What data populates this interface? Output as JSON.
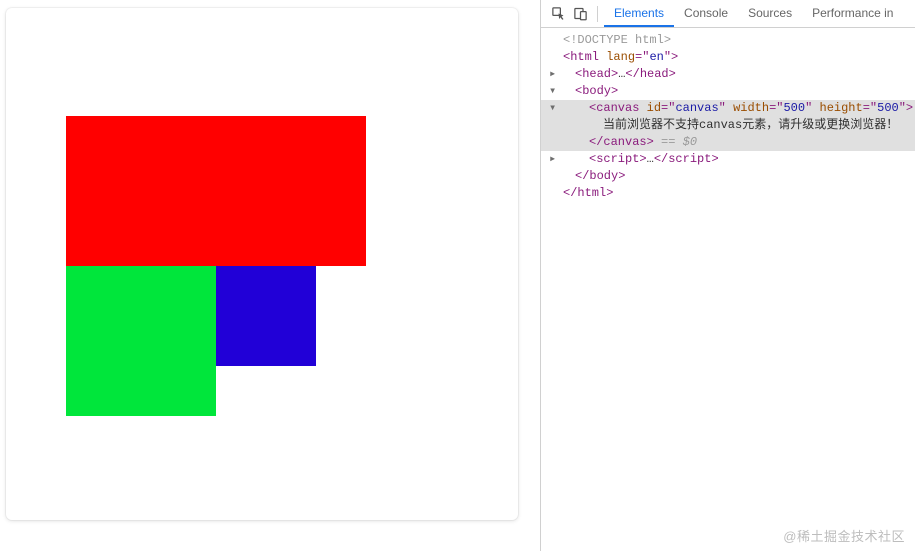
{
  "devtools": {
    "tabs": [
      "Elements",
      "Console",
      "Sources",
      "Performance in"
    ],
    "activeTabIndex": 0
  },
  "dom": {
    "doctype": "<!DOCTYPE html>",
    "htmlOpen": {
      "tag": "html",
      "attrs": [
        {
          "name": "lang",
          "value": "en"
        }
      ]
    },
    "head": {
      "tag": "head"
    },
    "body": {
      "tag": "body"
    },
    "canvasLine": {
      "tag": "canvas",
      "attrs": [
        {
          "name": "id",
          "value": "canvas"
        },
        {
          "name": "width",
          "value": "500"
        },
        {
          "name": "height",
          "value": "500"
        }
      ],
      "selectionSuffix": " == $0"
    },
    "canvasFallbackText": "当前浏览器不支持canvas元素，请升级或更换浏览器！",
    "canvasClose": "canvas",
    "script": {
      "tag": "script"
    },
    "bodyClose": "body",
    "htmlClose": "html"
  },
  "watermark": "@稀土掘金技术社区",
  "colors": {
    "red": "#ff0000",
    "green": "#00e63b",
    "blue": "#2100d7",
    "accent": "#1a73e8",
    "tag": "#8a1b7c",
    "attr": "#9a4d00",
    "val": "#1a1aa6"
  }
}
